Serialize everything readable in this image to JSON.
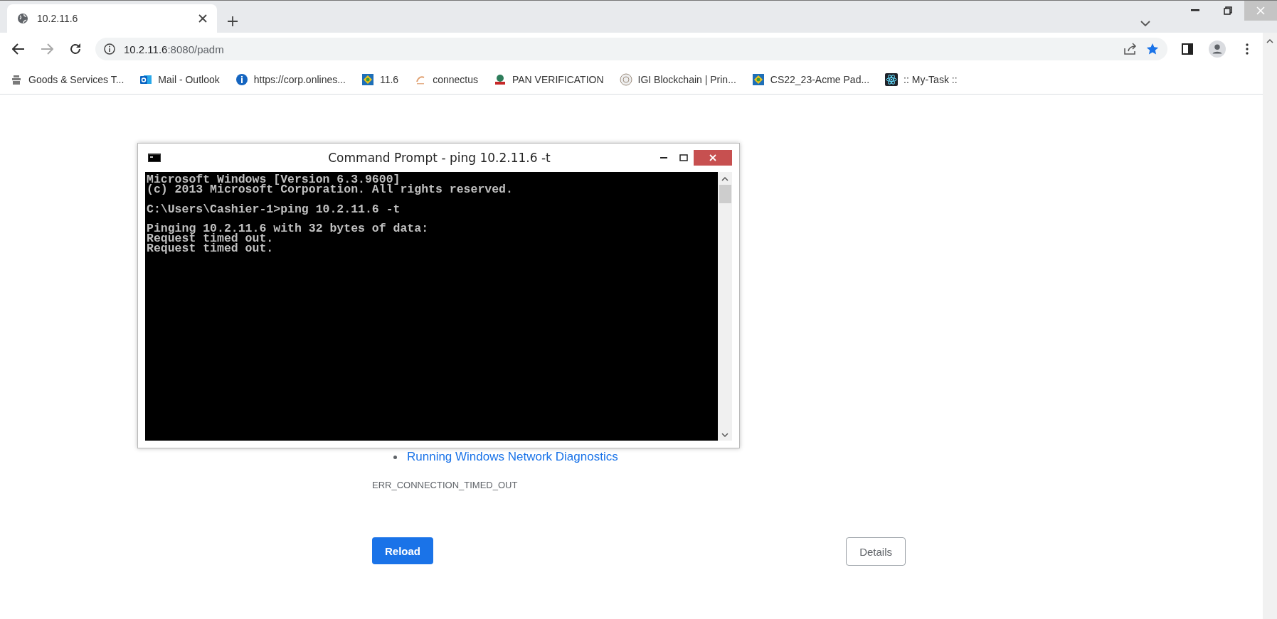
{
  "browser": {
    "tabs": [
      {
        "title": "10.2.11.6",
        "selected": true
      }
    ],
    "address": {
      "host": "10.2.11.6",
      "rest": ":8080/padm"
    },
    "bookmarks": [
      {
        "label": "Goods & Services T...",
        "kind": "emblem"
      },
      {
        "label": "Mail - Outlook",
        "kind": "mail"
      },
      {
        "label": "https://corp.onlines...",
        "kind": "info"
      },
      {
        "label": "11.6",
        "kind": "tile"
      },
      {
        "label": "connectus",
        "kind": "mark"
      },
      {
        "label": "PAN VERIFICATION",
        "kind": "seal"
      },
      {
        "label": "IGI Blockchain | Prin...",
        "kind": "badge"
      },
      {
        "label": "CS22_23-Acme Pad...",
        "kind": "tile"
      },
      {
        "label": ":: My-Task ::",
        "kind": "atom"
      }
    ]
  },
  "console_window": {
    "title": "Command Prompt - ping  10.2.11.6 -t",
    "blocks": [
      [
        "Microsoft Windows [Version 6.3.9600]",
        "(c) 2013 Microsoft Corporation. All rights reserved."
      ],
      [
        "C:\\Users\\Cashier-1>ping 10.2.11.6 -t"
      ],
      [
        "Pinging 10.2.11.6 with 32 bytes of data:",
        "Request timed out.",
        "Request timed out."
      ]
    ]
  },
  "error_page": {
    "links": [
      "Running Windows Network Diagnostics"
    ],
    "error_code": "ERR_CONNECTION_TIMED_OUT",
    "buttons": [
      {
        "label": "Reload",
        "kind": "primary"
      },
      {
        "label": "Details",
        "kind": "secondary"
      }
    ]
  }
}
